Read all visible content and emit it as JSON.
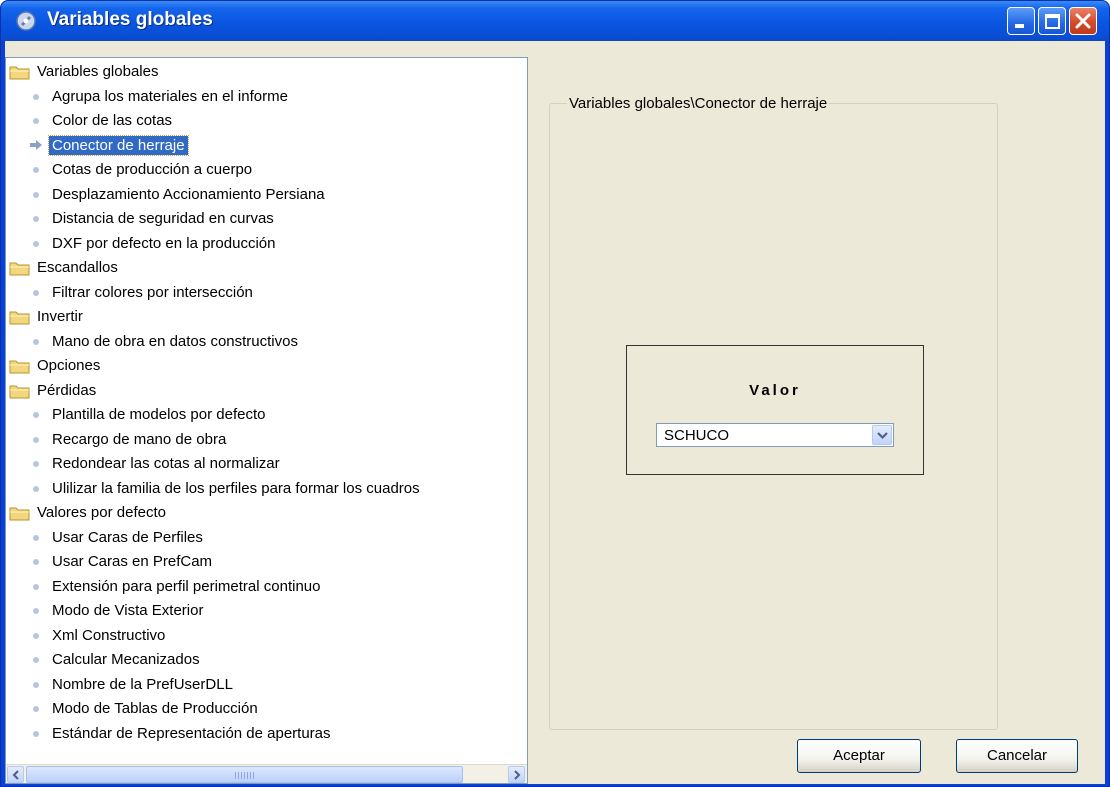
{
  "window": {
    "title": "Variables globales",
    "icon": "app-gear-icon",
    "controls": [
      "minimize-icon",
      "maximize-icon",
      "close-icon"
    ]
  },
  "tree": {
    "items": [
      {
        "label": "Variables globales",
        "type": "folder"
      },
      {
        "label": "Agrupa los materiales en el informe",
        "type": "item"
      },
      {
        "label": "Color de las cotas",
        "type": "item"
      },
      {
        "label": "Conector de herraje",
        "type": "item",
        "selected": true
      },
      {
        "label": "Cotas de producción a cuerpo",
        "type": "item"
      },
      {
        "label": "Desplazamiento Accionamiento Persiana",
        "type": "item"
      },
      {
        "label": "Distancia de seguridad en curvas",
        "type": "item"
      },
      {
        "label": "DXF por defecto en la producción",
        "type": "item"
      },
      {
        "label": "Escandallos",
        "type": "folder"
      },
      {
        "label": "Filtrar colores por intersección",
        "type": "item"
      },
      {
        "label": "Invertir",
        "type": "folder"
      },
      {
        "label": "Mano de obra en datos constructivos",
        "type": "item"
      },
      {
        "label": "Opciones",
        "type": "folder"
      },
      {
        "label": "Pérdidas",
        "type": "folder"
      },
      {
        "label": "Plantilla de modelos por defecto",
        "type": "item"
      },
      {
        "label": "Recargo de mano de obra",
        "type": "item"
      },
      {
        "label": "Redondear las cotas al normalizar",
        "type": "item"
      },
      {
        "label": "Ulilizar la familia de los perfiles para formar los cuadros",
        "type": "item"
      },
      {
        "label": "Valores por defecto",
        "type": "folder"
      },
      {
        "label": "Usar Caras de Perfiles",
        "type": "item"
      },
      {
        "label": "Usar Caras en PrefCam",
        "type": "item"
      },
      {
        "label": "Extensión para perfil perimetral continuo",
        "type": "item"
      },
      {
        "label": "Modo de Vista Exterior",
        "type": "item"
      },
      {
        "label": "Xml Constructivo",
        "type": "item"
      },
      {
        "label": "Calcular Mecanizados",
        "type": "item"
      },
      {
        "label": "Nombre de la PrefUserDLL",
        "type": "item"
      },
      {
        "label": "Modo de Tablas de Producción",
        "type": "item"
      },
      {
        "label": "Estándar de Representación de aperturas",
        "type": "item"
      }
    ]
  },
  "detail": {
    "group_label": "Variables globales\\Conector de herraje",
    "valor_title": "Valor",
    "combo_value": "SCHUCO"
  },
  "buttons": {
    "accept": "Aceptar",
    "cancel": "Cancelar"
  },
  "colors": {
    "titlebar": "#0a55e0",
    "selection": "#316ac5",
    "dialog_bg": "#ece9d8"
  }
}
